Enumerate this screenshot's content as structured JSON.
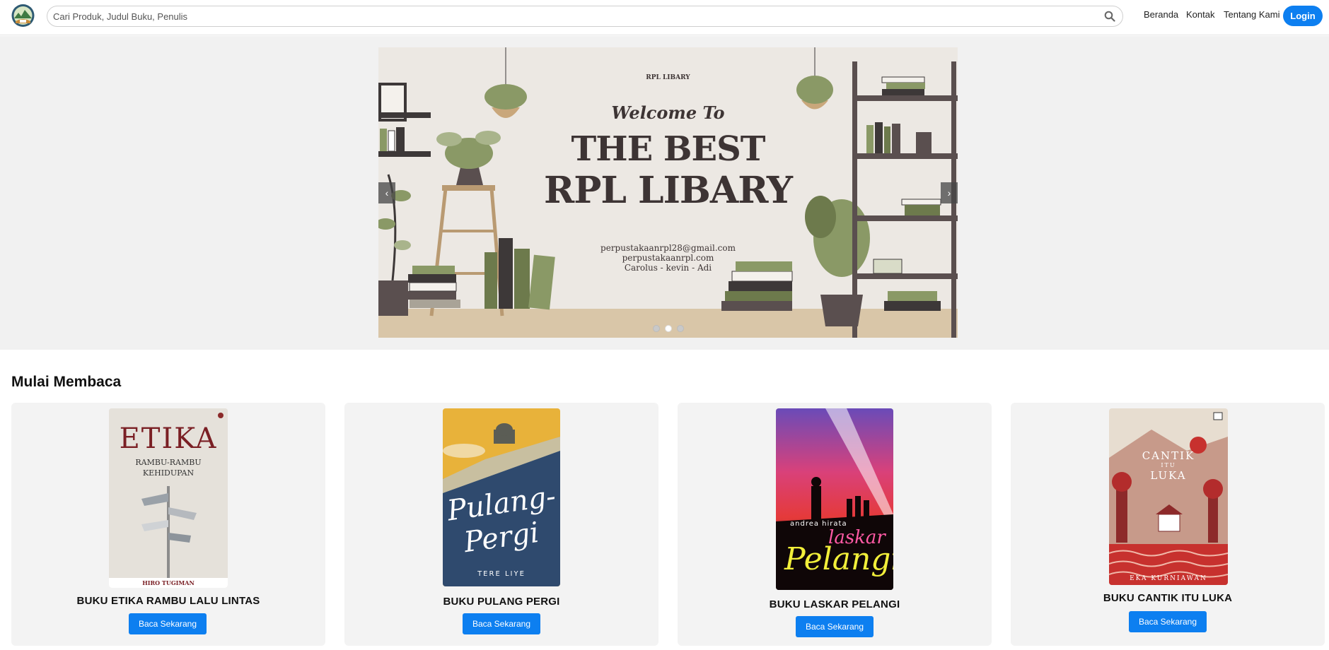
{
  "nav": {
    "search_placeholder": "Cari Produk, Judul Buku, Penulis",
    "links": [
      "Beranda",
      "Kontak",
      "Tentang Kami"
    ],
    "login_label": "Login"
  },
  "hero": {
    "brand": "RPL LIBARY",
    "welcome": "Welcome To",
    "headline_1": "THE BEST",
    "headline_2": "RPL LIBARY",
    "email": "perpustakaanrpl28@gmail.com",
    "website": "perpustakaanrpl.com",
    "credits": "Carolus - kevin - Adi",
    "prev_symbol": "‹",
    "next_symbol": "›",
    "slide_count": 3,
    "active_slide": 2
  },
  "section": {
    "title": "Mulai Membaca"
  },
  "books": [
    {
      "title": "BUKU ETIKA RAMBU LALU LINTAS",
      "button": "Baca Sekarang",
      "cover_title": "ETIKA",
      "cover_subtitle_1": "RAMBU-RAMBU",
      "cover_subtitle_2": "KEHIDUPAN",
      "cover_author": "HIRO TUGIMAN"
    },
    {
      "title": "BUKU PULANG PERGI",
      "button": "Baca Sekarang",
      "cover_title_1": "Pulang-",
      "cover_title_2": "Pergi",
      "cover_author": "TERE LIYE"
    },
    {
      "title": "BUKU LASKAR PELANGI",
      "button": "Baca Sekarang",
      "cover_author": "andrea hirata",
      "cover_title_1": "laskar",
      "cover_title_2": "Pelangi"
    },
    {
      "title": "BUKU CANTIK ITU LUKA",
      "button": "Baca Sekarang",
      "cover_title_1": "CANTIK",
      "cover_title_2": "ITU",
      "cover_title_3": "LUKA",
      "cover_author": "EKA KURNIAWAN"
    }
  ],
  "colors": {
    "accent": "#0d7ff0",
    "hero_bg": "#f1f1f1",
    "card_bg": "#f3f3f3"
  }
}
